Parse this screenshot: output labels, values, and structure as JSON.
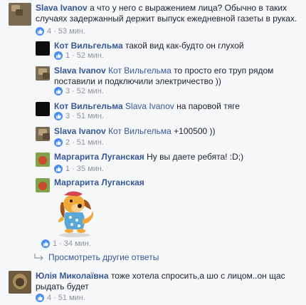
{
  "comments": [
    {
      "author": "Slava Ivanov",
      "text": "а что у него с выражением лица? Обычно в таких случаях задержанный держит выпуск ежедневной газеты в руках.",
      "likes": "4",
      "time": "53 мин."
    }
  ],
  "replies": [
    {
      "author": "Кот Вильгельма",
      "text": "такой вид как-будто он глухой",
      "likes": "1",
      "time": "52 мин."
    },
    {
      "author": "Slava Ivanov",
      "mention": "Кот Вильгельма",
      "text": "то просто его труп рядом поставили и подключили электричество ))",
      "likes": "3",
      "time": "52 мин."
    },
    {
      "author": "Кот Вильгельма",
      "mention": "Slava Ivanov",
      "text": "на паровой тяге",
      "likes": "3",
      "time": "51 мин."
    },
    {
      "author": "Slava Ivanov",
      "mention": "Кот Вильгельма",
      "text": "+100500 ))",
      "likes": "2",
      "time": "51 мин."
    },
    {
      "author": "Маргарита Луганская",
      "text": "Ну вы даете ребята! :D;)",
      "likes": "1",
      "time": "35 мин."
    },
    {
      "author": "Маргарита Луганская",
      "text": "",
      "likes": "1",
      "time": "34 мин."
    }
  ],
  "more_replies_label": "Просмотреть другие ответы",
  "last_comment": {
    "author": "Юлія Миколаївна",
    "text": "тоже хотела спросить,а шо с лицом..он щас рыдать будет",
    "likes": "4",
    "time": "51 мин."
  },
  "colors": {
    "link": "#365899",
    "meta": "#90949c",
    "like": "#4b8ef2"
  },
  "icons": {
    "like": "thumbs-up-icon",
    "sticker": "dog-sticker-icon",
    "reply": "reply-arrow-icon"
  }
}
